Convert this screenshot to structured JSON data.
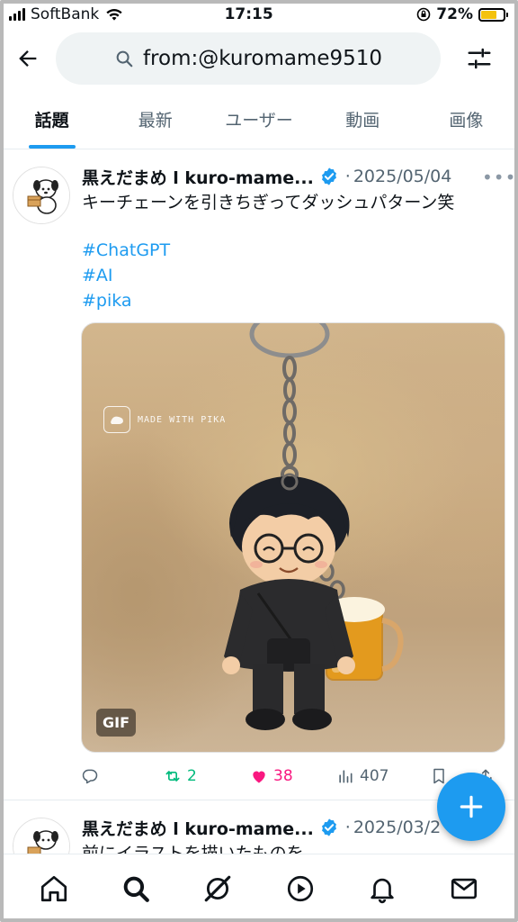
{
  "status_bar": {
    "carrier": "SoftBank",
    "time": "17:15",
    "battery_percent": "72%",
    "battery_level": 0.72,
    "battery_color": "#f4c20d"
  },
  "header": {
    "search_query": "from:@kuromame9510"
  },
  "tabs": [
    {
      "label": "話題",
      "active": true
    },
    {
      "label": "最新",
      "active": false
    },
    {
      "label": "ユーザー",
      "active": false
    },
    {
      "label": "動画",
      "active": false
    },
    {
      "label": "画像",
      "active": false
    }
  ],
  "posts": [
    {
      "author": "黒えだまめ l kuro-mame...",
      "date": "2025/05/04",
      "text": "キーチェーンを引きちぎってダッシュパターン笑",
      "hashtags": [
        "#ChatGPT",
        "#AI",
        "#pika"
      ],
      "media": {
        "watermark": "MADE WITH PIKA",
        "badge": "GIF"
      },
      "actions": {
        "reply": "",
        "retweets": "2",
        "likes": "38",
        "views": "407"
      }
    },
    {
      "author": "黒えだまめ l kuro-mame...",
      "date": "2025/03/2",
      "text": "前にイラストを描いたものを"
    }
  ],
  "colors": {
    "accent": "#1d9bf0",
    "retweet": "#00ba7c",
    "like": "#f91880",
    "muted": "#536471"
  },
  "icons": {
    "back": "arrow-left-icon",
    "search": "search-icon",
    "filter": "sliders-icon",
    "verified": "verified-badge-icon",
    "more": "more-dots-icon",
    "reply": "reply-icon",
    "retweet": "retweet-icon",
    "like": "heart-icon",
    "views": "views-icon",
    "bookmark": "bookmark-icon",
    "share": "share-icon",
    "compose": "plus-icon",
    "nav": [
      "home-icon",
      "search-icon",
      "grok-icon",
      "video-icon",
      "bell-icon",
      "mail-icon"
    ]
  }
}
